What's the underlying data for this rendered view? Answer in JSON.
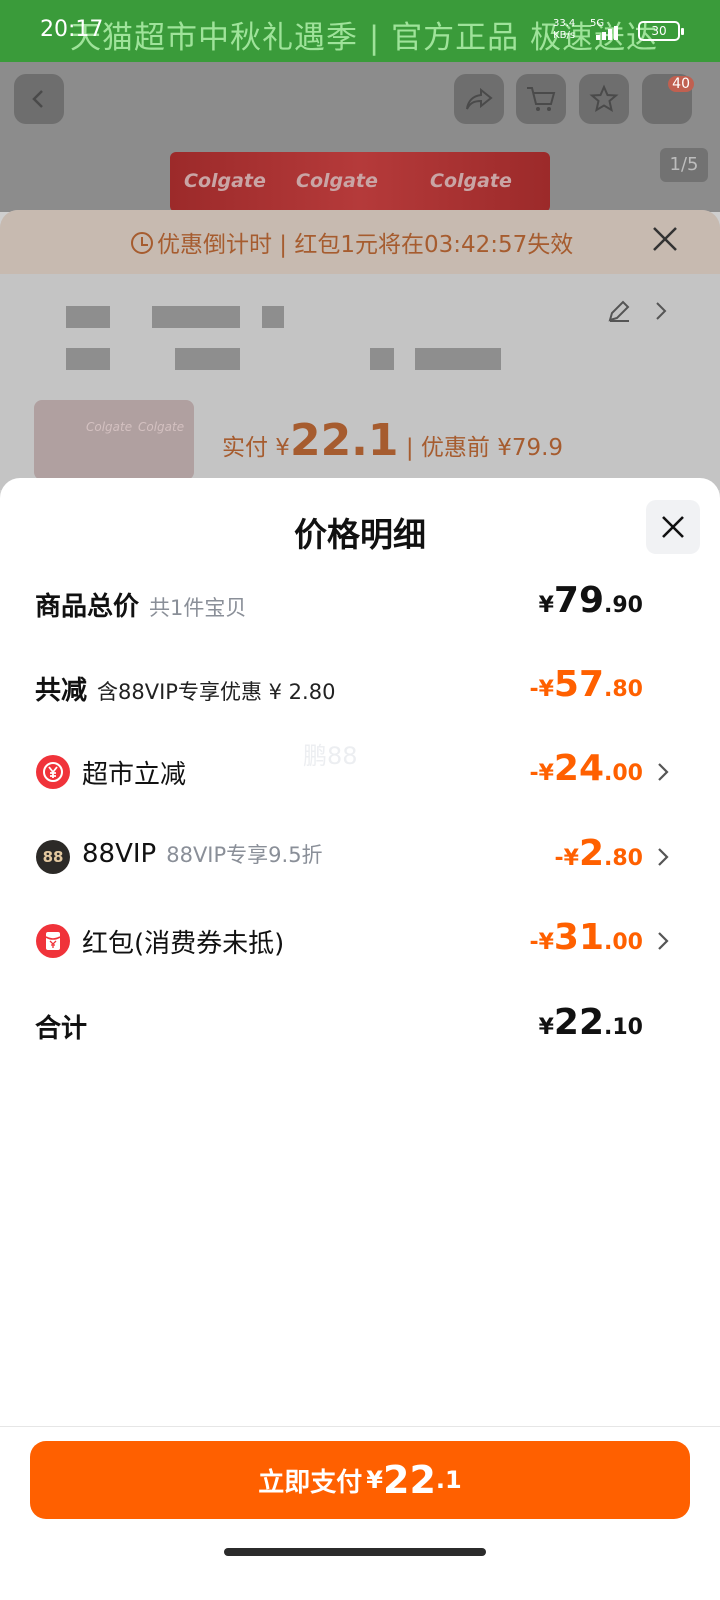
{
  "status_bar": {
    "time": "20:17",
    "net_speed_value": "33.4",
    "net_speed_unit": "KB/s",
    "network": "5G",
    "battery": "30"
  },
  "background": {
    "banner_text": "天猫超市中秋礼遇季 | 官方正品 极速送达",
    "cart_badge": "40",
    "gallery_counter": "1/5",
    "product_brand": "Colgate",
    "countdown_text": "优惠倒计时 | 红包1元将在03:42:57失效",
    "pay_prefix": "实付 ¥",
    "pay_amount": "22.1",
    "pay_suffix": " | 优惠前 ¥79.9"
  },
  "sheet": {
    "title": "价格明细",
    "rows": [
      {
        "label": "商品总价",
        "sub": "共1件宝贝",
        "sym": "¥",
        "int": "79",
        "dec": ".90"
      },
      {
        "label": "共减",
        "sub": "含88VIP专享优惠 ¥ 2.80",
        "sym": "-¥",
        "int": "57",
        "dec": ".80"
      },
      {
        "label": "超市立减",
        "sub": "",
        "sym": "-¥",
        "int": "24",
        "dec": ".00"
      },
      {
        "label": "88VIP",
        "icon_text": "88",
        "sub": "88VIP专享9.5折",
        "sym": "-¥",
        "int": "2",
        "dec": ".80"
      },
      {
        "label": "红包(消费券未抵)",
        "sub": "",
        "sym": "-¥",
        "int": "31",
        "dec": ".00"
      },
      {
        "label": "合计",
        "sub": "",
        "sym": "¥",
        "int": "22",
        "dec": ".10"
      }
    ],
    "watermark": "鹏88"
  },
  "footer": {
    "pay_label": "立即支付",
    "pay_sym": "¥",
    "pay_int": "22",
    "pay_dec": ".1"
  },
  "colors": {
    "accent": "#ff6000",
    "coupon_red": "#f0333a",
    "vip_dark": "#2c2a27"
  },
  "icons": {
    "back": "chevron-left-icon",
    "share": "share-icon",
    "cart": "cart-icon",
    "favorite": "star-icon",
    "close": "close-icon",
    "edit": "edit-icon",
    "supermarket": "yuan-discount-icon",
    "vip": "vip-88-icon",
    "red_packet": "red-packet-icon"
  }
}
